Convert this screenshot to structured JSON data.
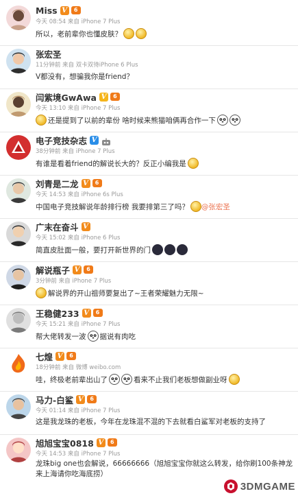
{
  "comments": [
    {
      "user": "Miss",
      "badge": "orange",
      "level": "6",
      "time": "今天 08:54",
      "src": "来自 iPhone 7 Plus",
      "text": "所以，老前辈你也懂皮肤？",
      "emoji": [
        "gold",
        "gold"
      ]
    },
    {
      "user": "张宏圣",
      "badge": "none",
      "level": "",
      "time": "11分钟前",
      "src": "来自 双卡双待iPhone 6 Plus",
      "text": "V都没有，想骗我你是friend？",
      "emoji": []
    },
    {
      "user": "闫紫境GwAwa",
      "badge": "yellow",
      "level": "6",
      "time": "今天 13:10",
      "src": "来自 iPhone 7 Plus",
      "text": "还是提到了以前的辈份 啥时候来熊猫咱俩再合作一下",
      "emoji": [
        "gold-pre",
        "panda",
        "panda"
      ]
    },
    {
      "user": "电子竞技杂志",
      "badge": "blue",
      "level": "",
      "time": "38分钟前",
      "src": "来自 iPhone 7 Plus",
      "text": "有谁是看着friend的解说长大的？反正小编我是",
      "emoji": [
        "gold"
      ]
    },
    {
      "user": "刘青是二龙",
      "badge": "orange",
      "level": "6",
      "time": "今天 14:53",
      "src": "来自 iPhone 6s Plus",
      "text": "中国电子竞技解说年龄排行榜 我要排第三了吗？",
      "mention": "@张宏圣",
      "emoji": [
        "gold"
      ]
    },
    {
      "user": "广末在奋斗",
      "badge": "orange",
      "level": "",
      "time": "今天 15:02",
      "src": "来自 iPhone 6 Plus",
      "text": "简直皮肚面一般，要打开新世界的门",
      "emoji": [
        "dark",
        "dark",
        "dark"
      ]
    },
    {
      "user": "解说瓶子",
      "badge": "orange",
      "level": "6",
      "time": "3分钟前",
      "src": "来自 iPhone 7 Plus",
      "text": "解说界的开山祖师要复出了~王者荣耀魅力无限~",
      "emoji": [
        "gold-pre"
      ]
    },
    {
      "user": "王稳健233",
      "badge": "orange",
      "level": "6",
      "time": "今天 15:21",
      "src": "来自 iPhone 7 Plus",
      "text": "帮大佬转发一波",
      "text2": "据说有肉吃",
      "emoji": [
        "panda-mid"
      ]
    },
    {
      "user": "七煌",
      "badge": "orange",
      "level": "6",
      "time": "18分钟前",
      "src": "来自 微博 weibo.com",
      "text": "哇，终极老前辈出山了",
      "text2": "看来不止我们老板想做副业呀",
      "emoji": [
        "panda-mid",
        "panda-mid",
        "gold"
      ]
    },
    {
      "user": "马力-白鲨",
      "badge": "orange",
      "level": "6",
      "time": "今天 01:14",
      "src": "来自 iPhone 7 Plus",
      "text": "这是我龙珠的老板，今年在龙珠混不混的下去就看白鲨军对老板的支持了",
      "emoji": []
    },
    {
      "user": "旭旭宝宝0818",
      "badge": "orange",
      "level": "6",
      "time": "今天 14:53",
      "src": "来自 iPhone 7 Plus",
      "text": "龙珠big one也会解说，66666666（旭旭宝宝你就这么转发，给你刷100条神龙来上海请你吃海底捞）",
      "emoji": []
    }
  ],
  "watermark": "3DMGAME"
}
